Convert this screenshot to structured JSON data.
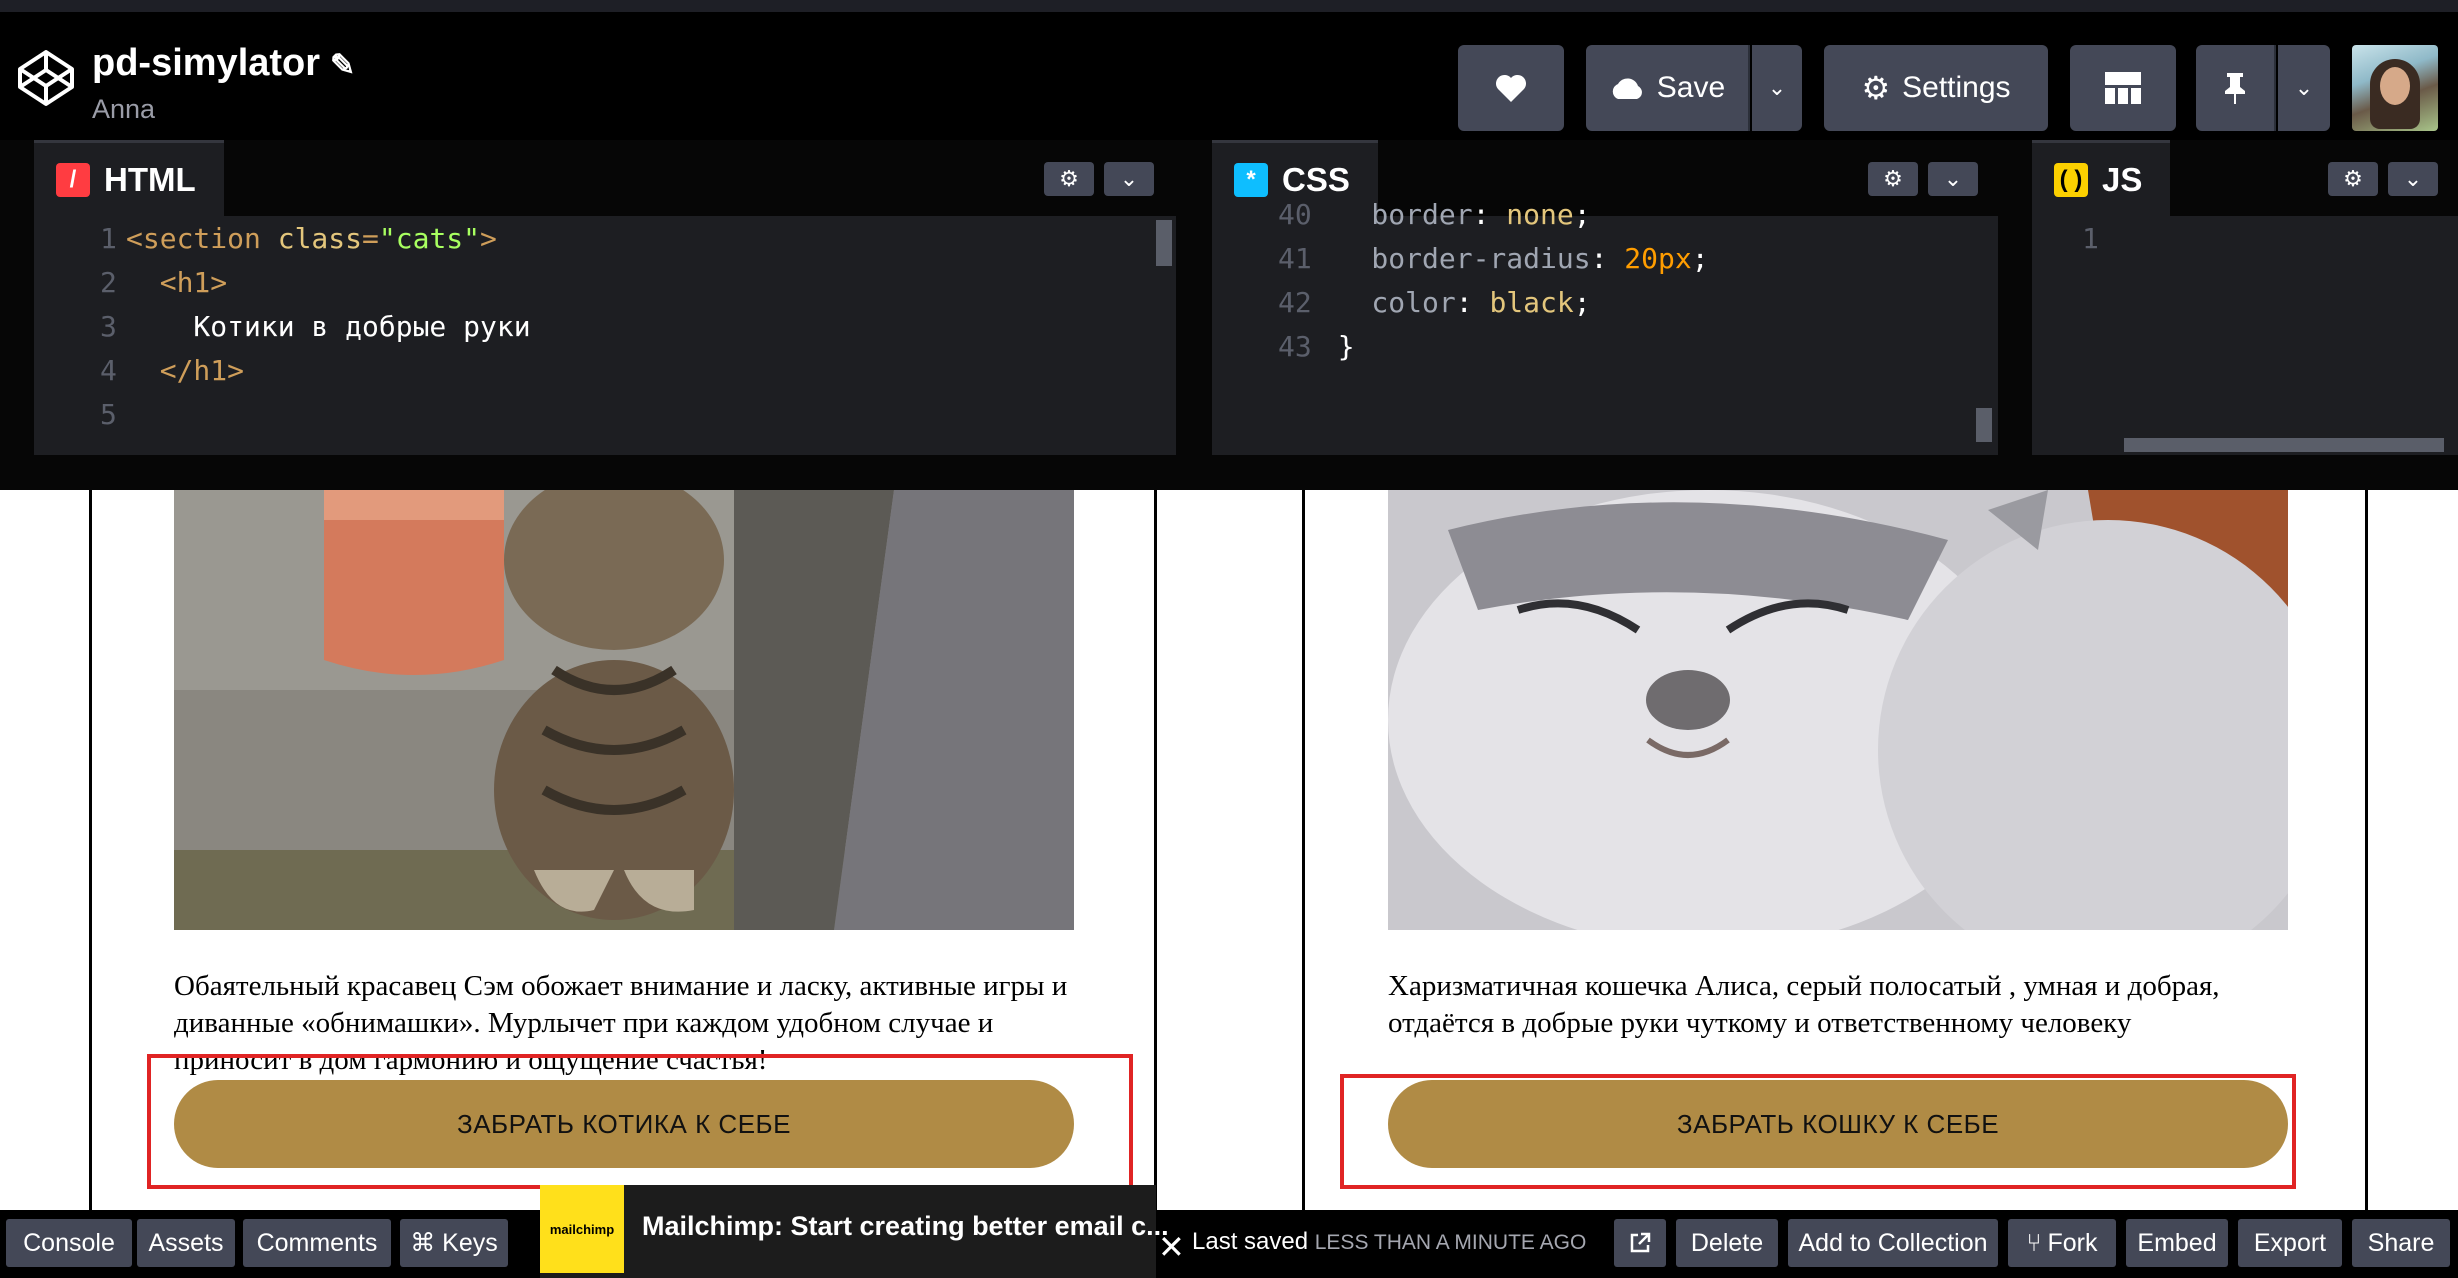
{
  "header": {
    "title": "pd-simylator",
    "author": "Anna",
    "save_label": "Save",
    "settings_label": "Settings"
  },
  "editors": {
    "html": {
      "label": "HTML",
      "lines": [
        {
          "n": "1",
          "parts": [
            [
              "tag",
              "<section "
            ],
            [
              "attr",
              "class"
            ],
            [
              "tag",
              "="
            ],
            [
              "str",
              "\"cats\""
            ],
            [
              "tag",
              ">"
            ]
          ]
        },
        {
          "n": "2",
          "parts": [
            [
              "txt",
              "  "
            ],
            [
              "tag",
              "<h1>"
            ]
          ]
        },
        {
          "n": "3",
          "parts": [
            [
              "txt",
              "    Котики в добрые руки"
            ]
          ]
        },
        {
          "n": "4",
          "parts": [
            [
              "txt",
              "  "
            ],
            [
              "tag",
              "</h1>"
            ]
          ]
        },
        {
          "n": "5",
          "parts": []
        }
      ]
    },
    "css": {
      "label": "CSS",
      "lines": [
        {
          "n": "40",
          "parts": [
            [
              "prop",
              "    border"
            ],
            [
              "txt",
              ": "
            ],
            [
              "attr",
              "none"
            ],
            [
              "txt",
              ";"
            ]
          ]
        },
        {
          "n": "41",
          "parts": [
            [
              "prop",
              "    border-radius"
            ],
            [
              "txt",
              ": "
            ],
            [
              "num",
              "20px"
            ],
            [
              "txt",
              ";"
            ]
          ]
        },
        {
          "n": "42",
          "parts": [
            [
              "prop",
              "    color"
            ],
            [
              "txt",
              ": "
            ],
            [
              "attr",
              "black"
            ],
            [
              "txt",
              ";"
            ]
          ]
        },
        {
          "n": "43",
          "parts": [
            [
              "txt",
              "  }"
            ]
          ]
        }
      ]
    },
    "js": {
      "label": "JS",
      "lines": [
        {
          "n": "1",
          "parts": []
        }
      ]
    }
  },
  "cards": [
    {
      "text": "Обаятельный красавец Сэм обожает внимание и ласку, активные игры и диванные «обнимашки». Мурлычет при каждом удобном случае и приносит в дом гармонию и ощущение счастья!",
      "button": "ЗАБРАТЬ КОТИКА К СЕБЕ"
    },
    {
      "text": "Харизматичная кошечка Алиса, серый полосатый , умная и добрая, отдаётся в добрые руки чуткому и ответственному человеку",
      "button": "ЗАБРАТЬ КОШКУ К СЕБЕ"
    }
  ],
  "footer": {
    "console": "Console",
    "assets": "Assets",
    "comments": "Comments",
    "keys": "⌘ Keys",
    "ad_brand": "mailchimp",
    "ad_text": "Mailchimp: Start creating better email c...",
    "saved_prefix": "Last saved",
    "saved_time": "LESS THAN A MINUTE AGO",
    "delete": "Delete",
    "add_to_collection": "Add to Collection",
    "fork": "Fork",
    "embed": "Embed",
    "export": "Export",
    "share": "Share"
  },
  "colors": {
    "accent_button": "#b08b45",
    "highlight": "#e02424",
    "toolbar": "#444857"
  }
}
